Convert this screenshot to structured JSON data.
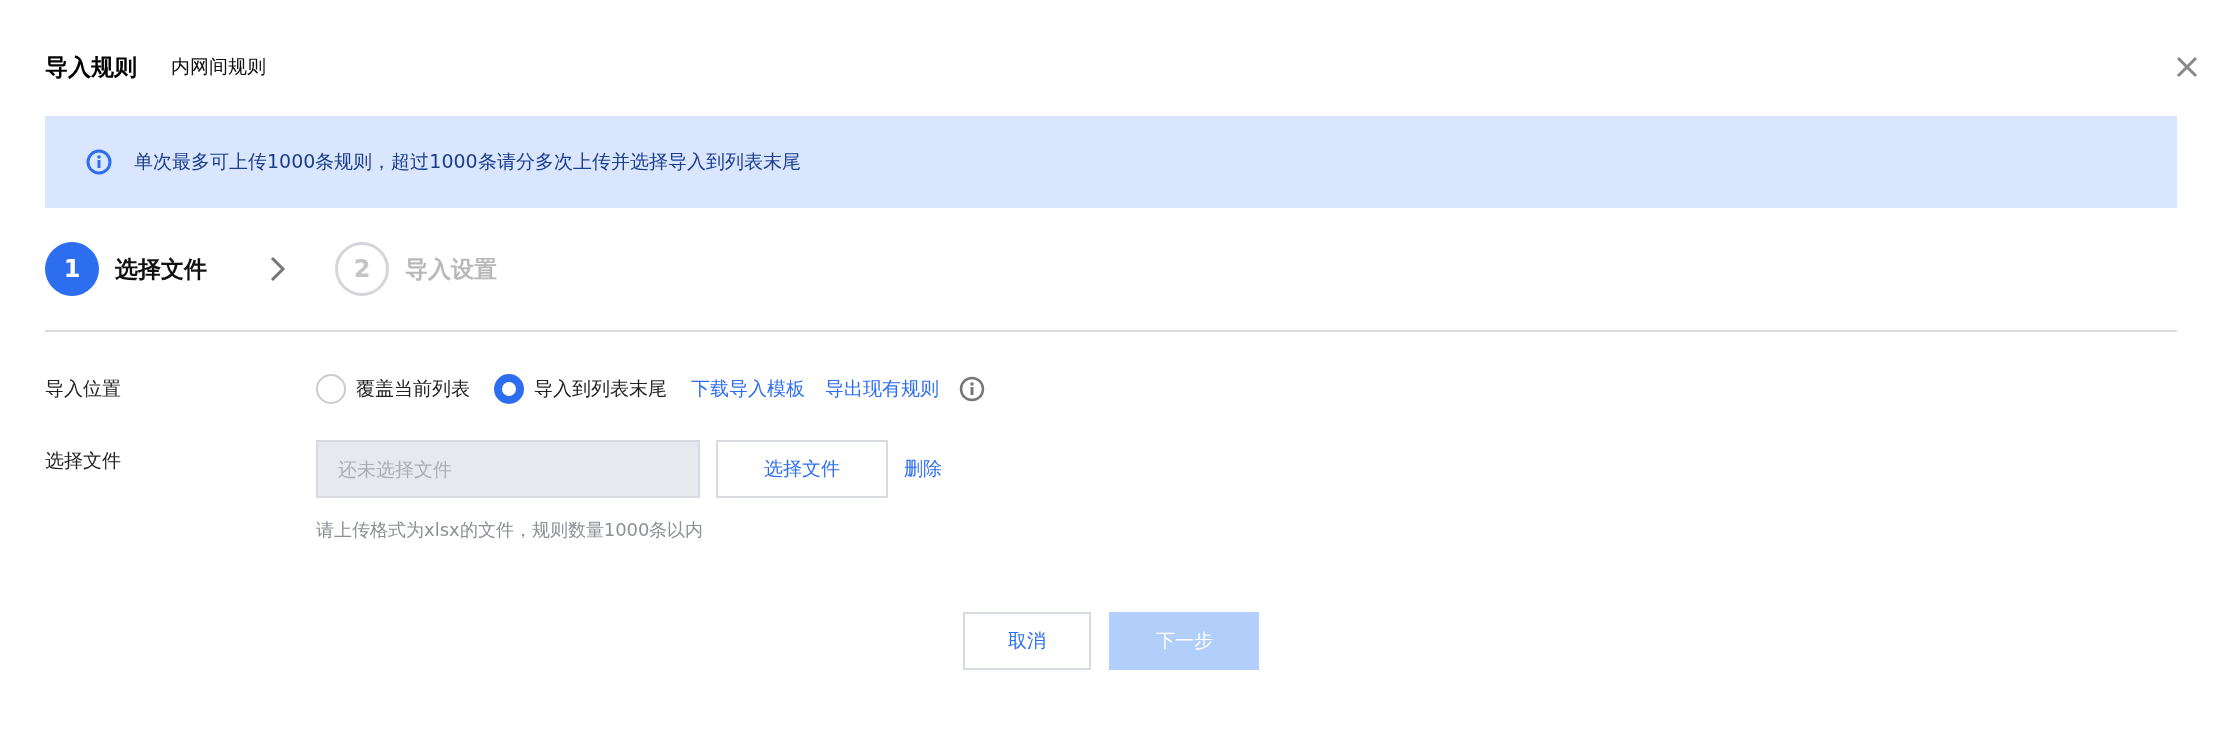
{
  "dialog": {
    "title": "导入规则",
    "subtitle": "内网间规则"
  },
  "notice": {
    "text": "单次最多可上传1000条规则，超过1000条请分多次上传并选择导入到列表末尾"
  },
  "steps": [
    {
      "number": "1",
      "label": "选择文件",
      "selected": true
    },
    {
      "number": "2",
      "label": "导入设置",
      "selected": false
    }
  ],
  "position": {
    "label": "导入位置",
    "options": [
      {
        "label": "覆盖当前列表",
        "selected": false
      },
      {
        "label": "导入到列表末尾",
        "selected": true
      }
    ],
    "links": [
      "下载导入模板",
      "导出现有规则"
    ]
  },
  "file": {
    "label": "选择文件",
    "placeholder": "还未选择文件",
    "button": "选择文件",
    "delete": "删除",
    "hint": "请上传格式为xlsx的文件，规则数量1000条以内"
  },
  "footer": [
    {
      "label": "取消",
      "kind": "secondary",
      "disabled": false
    },
    {
      "label": "下一步",
      "kind": "primary",
      "disabled": true
    }
  ]
}
